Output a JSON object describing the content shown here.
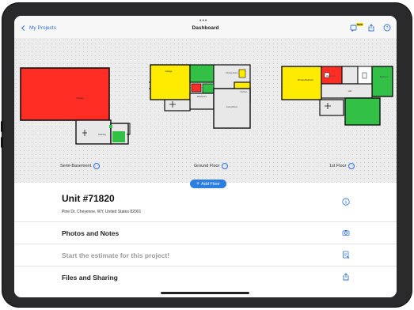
{
  "nav": {
    "back_label": "My Projects",
    "title": "Dashboard",
    "badge": "NEW"
  },
  "floors": [
    {
      "name": "Semi-Basement"
    },
    {
      "name": "Ground Floor"
    },
    {
      "name": "1st Floor"
    }
  ],
  "rooms": {
    "storage": "Storage",
    "stairway": "Stairway",
    "garage": "Garage",
    "dining": "Dining Room",
    "kitchen": "Kitchen",
    "living": "Living Room",
    "washroom": "Washroom",
    "primary": "Primary Bedroom",
    "hall": "Hall",
    "bedroom": "Bedroom",
    "bathroom": "Bathroom"
  },
  "add_floor_label": "Add Floor",
  "project": {
    "unit": "Unit #71820",
    "address": "Pine Dr, Cheyenne, WY, United States 82001"
  },
  "rows": {
    "photos": "Photos and Notes",
    "estimate": "Start the estimate for this project!",
    "files": "Files and Sharing"
  },
  "colors": {
    "accent": "#2a7fe0",
    "red": "#ff3b30",
    "yellow": "#ffeb00",
    "green": "#33c047"
  },
  "icons": {
    "back": "chevron-left-icon",
    "notes": "note-icon",
    "share": "share-icon",
    "help": "help-icon",
    "info": "info-icon",
    "camera": "camera-icon",
    "estimate": "estimate-icon",
    "more": "ellipsis-icon"
  }
}
